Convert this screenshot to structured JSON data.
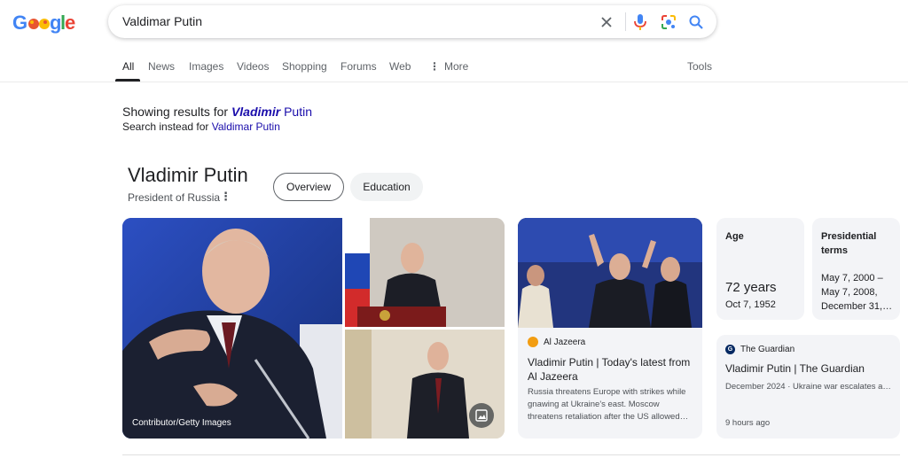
{
  "search": {
    "query": "Valdimar Putin"
  },
  "tabs": {
    "all": "All",
    "news": "News",
    "images": "Images",
    "videos": "Videos",
    "shopping": "Shopping",
    "forums": "Forums",
    "web": "Web",
    "more": "More",
    "tools": "Tools"
  },
  "spelling": {
    "showing_prefix": "Showing results for",
    "corrected_bold": "Vladimir",
    "corrected_rest": " Putin",
    "instead_prefix": "Search instead for",
    "original": "Valdimar Putin"
  },
  "knowledge_panel": {
    "title": "Vladimir Putin",
    "subtitle": "President of Russia",
    "chips": [
      "Overview",
      "Education"
    ],
    "image_credit": "Contributor/Getty Images"
  },
  "news_card": {
    "source": "Al Jazeera",
    "title": "Vladimir Putin | Today's latest from Al Jazeera",
    "snippet": "Russia threatens Europe with strikes while gnawing at Ukraine's east. Moscow threatens retaliation after the US allowed…"
  },
  "facts": {
    "age_label": "Age",
    "age_value": "72 years",
    "birth_date": "Oct 7, 1952",
    "terms_label": "Presidential terms",
    "terms_value": "May 7, 2000 – May 7, 2008, December 31,…"
  },
  "guardian_card": {
    "source": "The Guardian",
    "title": "Vladimir Putin | The Guardian",
    "snippet": "December 2024 · Ukraine war escalates a…",
    "time": "9 hours ago"
  },
  "colors": {
    "link": "#1a0dab",
    "blue": "#4285f4",
    "red": "#ea4335",
    "yellow": "#fbbc05",
    "green": "#34a853"
  }
}
